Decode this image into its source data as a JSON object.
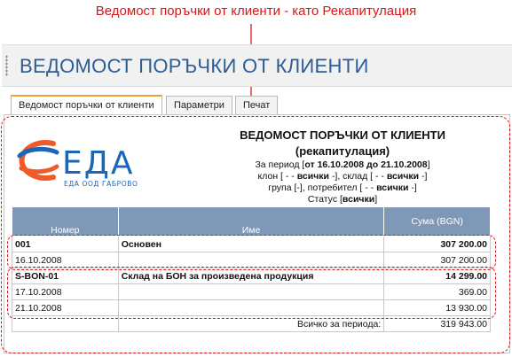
{
  "annotation": "Ведомост поръчки от клиенти - като Рекапитулация",
  "page_title": "ВЕДОМОСТ ПОРЪЧКИ ОТ КЛИЕНТИ",
  "tabs": [
    {
      "label": "Ведомост поръчки от клиенти",
      "active": true
    },
    {
      "label": "Параметри",
      "active": false
    },
    {
      "label": "Печат",
      "active": false
    }
  ],
  "logo": {
    "text": "ЕДА",
    "subtext": "ЕДА ООД ГАБРОВО"
  },
  "report": {
    "title": "ВЕДОМОСТ ПОРЪЧКИ ОТ КЛИЕНТИ",
    "subtitle": "(рекапитулация)",
    "period_prefix": "За период [",
    "period_from_label": "от",
    "period_from": "16.10.2008",
    "period_to_label": "до",
    "period_to": "21.10.2008",
    "period_suffix": "]",
    "line2": {
      "a": "клон [ - -",
      "b": "всички",
      "c": "-], склад [ - -",
      "d": "всички",
      "e": "-]"
    },
    "line3": {
      "a": "група [-], потребител [ - -",
      "b": "всички",
      "c": "-]"
    },
    "line4": {
      "a": "Статус [",
      "b": "всички",
      "c": "]"
    }
  },
  "table": {
    "columns": [
      "Номер",
      "Име",
      "Сума (BGN)"
    ],
    "rows": [
      {
        "number": "001",
        "name": "Основен",
        "sum": "307 200.00",
        "bold": true
      },
      {
        "number": "16.10.2008",
        "name": "",
        "sum": "307 200.00",
        "bold": false
      },
      {
        "number": "S-BON-01",
        "name": "Склад на БОН за произведена продукция",
        "sum": "14 299.00",
        "bold": true
      },
      {
        "number": "17.10.2008",
        "name": "",
        "sum": "369.00",
        "bold": false
      },
      {
        "number": "21.10.2008",
        "name": "",
        "sum": "13 930.00",
        "bold": false
      }
    ],
    "total_label": "Всичко за периода:",
    "total_value": "319 943.00"
  },
  "colors": {
    "annotation": "#d81818",
    "title": "#2a5c96",
    "table_header": "#7f98b8",
    "tab_accent": "#f0a030"
  }
}
